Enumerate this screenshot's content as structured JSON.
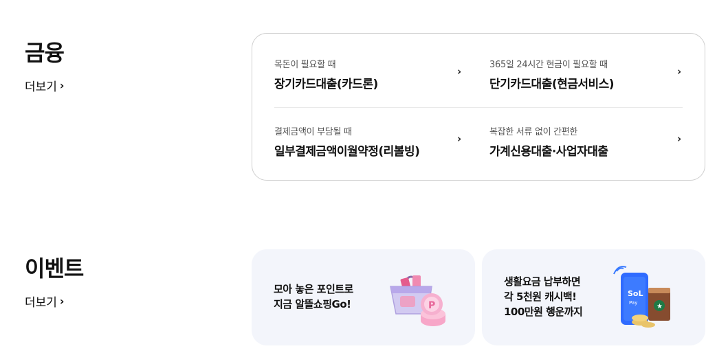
{
  "finance": {
    "title": "금융",
    "more_label": "더보기",
    "items": [
      {
        "sub": "목돈이 필요할 때",
        "main": "장기카드대출(카드론)"
      },
      {
        "sub": "365일 24시간 현금이 필요할 때",
        "main": "단기카드대출(현금서비스)"
      },
      {
        "sub": "결제금액이 부담될 때",
        "main": "일부결제금액이월약정(리볼빙)"
      },
      {
        "sub": "복잡한 서류 없이 간편한",
        "main": "가계신용대출·사업자대출"
      }
    ],
    "chevron_icon": "chevron-right-icon"
  },
  "event": {
    "title": "이벤트",
    "more_label": "더보기",
    "cards": [
      {
        "lines": [
          "모아 놓은 포인트로",
          "지금 알뜰쇼핑Go!"
        ],
        "image": "shopping-bag-points-illustration"
      },
      {
        "lines": [
          "생활요금 납부하면",
          "각 5천원 캐시백!",
          "100만원 행운까지"
        ],
        "image": "phone-pay-coffee-illustration"
      }
    ]
  },
  "colors": {
    "card_border": "#cfcfcf",
    "event_bg": "#f3f5fb",
    "text": "#111111",
    "sub_text": "#555555",
    "phone_blue": "#2f6bff"
  }
}
